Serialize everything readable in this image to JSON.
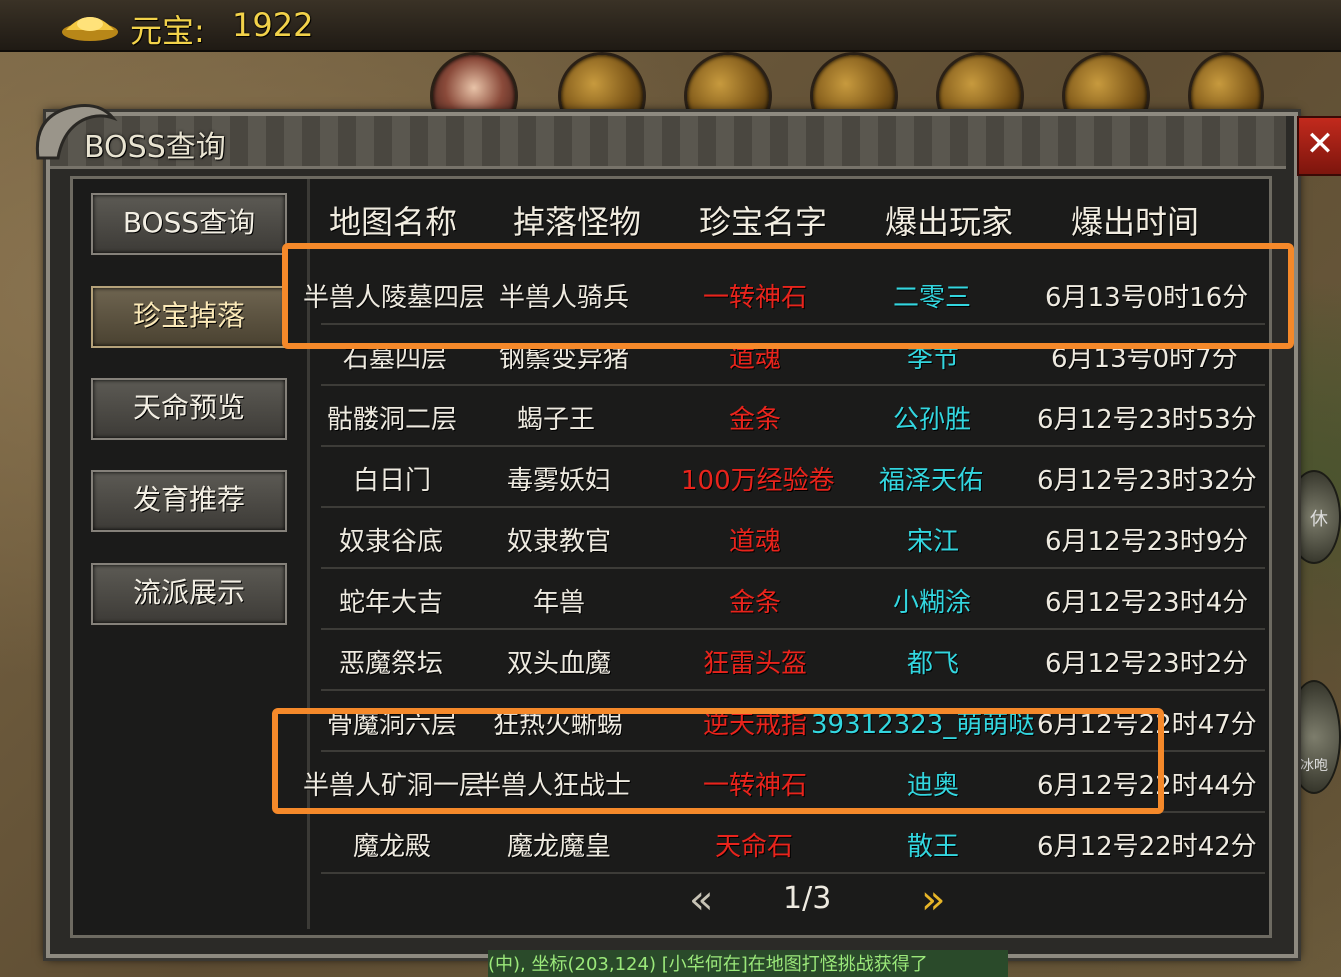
{
  "currency": {
    "label": "元宝:",
    "value": "1922"
  },
  "panel": {
    "title": "BOSS查询",
    "close_symbol": "✕"
  },
  "sidebar": {
    "items": [
      {
        "label": "BOSS查询",
        "active": false
      },
      {
        "label": "珍宝掉落",
        "active": true
      },
      {
        "label": "天命预览",
        "active": false
      },
      {
        "label": "发育推荐",
        "active": false
      },
      {
        "label": "流派展示",
        "active": false
      }
    ]
  },
  "table": {
    "headers": [
      "地图名称",
      "掉落怪物",
      "珍宝名字",
      "爆出玩家",
      "爆出时间"
    ],
    "rows": [
      {
        "map": "半兽人陵墓四层",
        "monster": "半兽人骑兵",
        "item": "一转神石",
        "player": "二零三",
        "time": "6月13号0时16分"
      },
      {
        "map": "石墓四层",
        "monster": "钢鬃变异猪",
        "item": "道魂",
        "player": "李节",
        "time": "6月13号0时7分"
      },
      {
        "map": "骷髅洞二层",
        "monster": "蝎子王",
        "item": "金条",
        "player": "公孙胜",
        "time": "6月12号23时53分"
      },
      {
        "map": "白日门",
        "monster": "毒雾妖妇",
        "item": "100万经验卷",
        "player": "福泽天佑",
        "time": "6月12号23时32分"
      },
      {
        "map": "奴隶谷底",
        "monster": "奴隶教官",
        "item": "道魂",
        "player": "宋江",
        "time": "6月12号23时9分"
      },
      {
        "map": "蛇年大吉",
        "monster": "年兽",
        "item": "金条",
        "player": "小糊涂",
        "time": "6月12号23时4分"
      },
      {
        "map": "恶魔祭坛",
        "monster": "双头血魔",
        "item": "狂雷头盔",
        "player": "都飞",
        "time": "6月12号23时2分"
      },
      {
        "map": "骨魔洞六层",
        "monster": "狂热火蜥蜴",
        "item": "逆天戒指",
        "player": "39312323_萌萌哒",
        "time": "6月12号22时47分"
      },
      {
        "map": "半兽人矿洞一层",
        "monster": "半兽人狂战士",
        "item": "一转神石",
        "player": "迪奥",
        "time": "6月12号22时44分"
      },
      {
        "map": "魔龙殿",
        "monster": "魔龙魔皇",
        "item": "天命石",
        "player": "散王",
        "time": "6月12号22时42分"
      }
    ]
  },
  "pager": {
    "text": "1/3",
    "prev_icon": "chevron-left-icon",
    "next_icon": "chevron-right-icon"
  },
  "chat": {
    "text": "(中), 坐标(203,124) [小华何在]在地图打怪挑战获得了"
  },
  "side": {
    "rest_label": "休",
    "ice_label": "冰咆"
  },
  "colors": {
    "highlight": "#f5892a",
    "item_red": "#e8241c",
    "player_cyan": "#33d6df",
    "gold": "#f2d24a"
  }
}
